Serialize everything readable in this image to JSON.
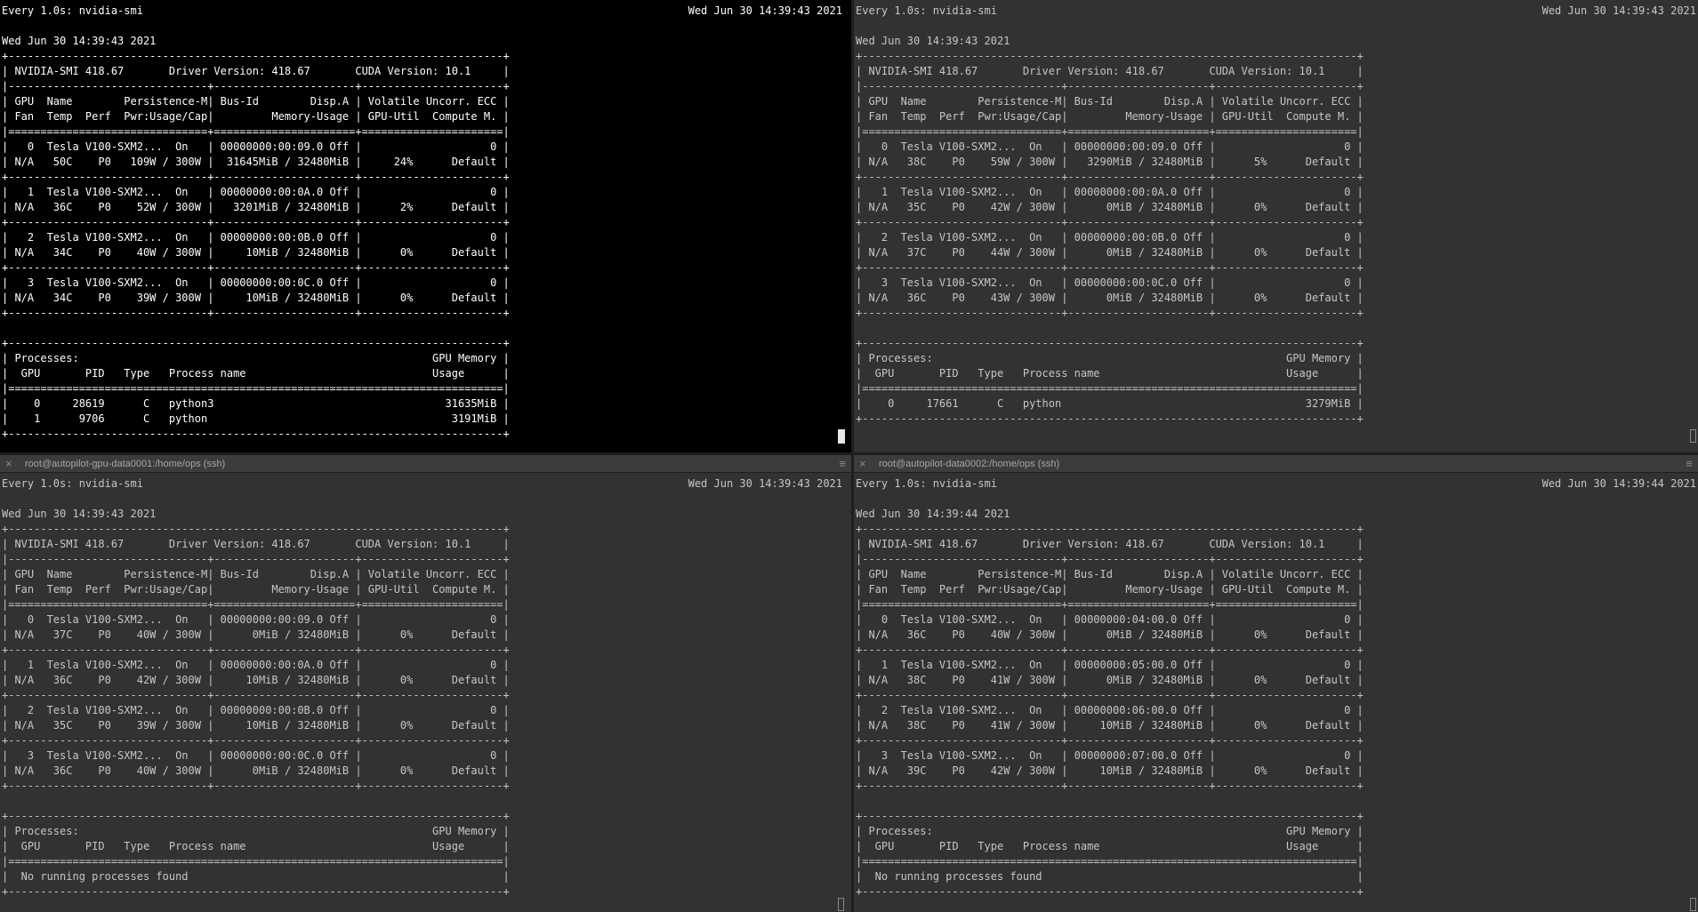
{
  "panes": [
    {
      "title": "",
      "watch_header": "Every 1.0s: nvidia-smi",
      "timestamp": "Wed Jun 30 14:39:43 2021",
      "date_line": "Wed Jun 30 14:39:43 2021",
      "smi_output": "+-----------------------------------------------------------------------------+\n| NVIDIA-SMI 418.67       Driver Version: 418.67       CUDA Version: 10.1     |\n|-------------------------------+----------------------+----------------------+\n| GPU  Name        Persistence-M| Bus-Id        Disp.A | Volatile Uncorr. ECC |\n| Fan  Temp  Perf  Pwr:Usage/Cap|         Memory-Usage | GPU-Util  Compute M. |\n|===============================+======================+======================|\n|   0  Tesla V100-SXM2...  On   | 00000000:00:09.0 Off |                    0 |\n| N/A   50C    P0   109W / 300W |  31645MiB / 32480MiB |     24%      Default |\n+-------------------------------+----------------------+----------------------+\n|   1  Tesla V100-SXM2...  On   | 00000000:00:0A.0 Off |                    0 |\n| N/A   36C    P0    52W / 300W |   3201MiB / 32480MiB |      2%      Default |\n+-------------------------------+----------------------+----------------------+\n|   2  Tesla V100-SXM2...  On   | 00000000:00:0B.0 Off |                    0 |\n| N/A   34C    P0    40W / 300W |     10MiB / 32480MiB |      0%      Default |\n+-------------------------------+----------------------+----------------------+\n|   3  Tesla V100-SXM2...  On   | 00000000:00:0C.0 Off |                    0 |\n| N/A   34C    P0    39W / 300W |     10MiB / 32480MiB |      0%      Default |\n+-------------------------------+----------------------+----------------------+\n\n+-----------------------------------------------------------------------------+\n| Processes:                                                       GPU Memory |\n|  GPU       PID   Type   Process name                             Usage      |\n|=============================================================================|\n|    0     28619      C   python3                                    31635MiB |\n|    1      9706      C   python                                      3191MiB |\n+-----------------------------------------------------------------------------+"
    },
    {
      "title": "",
      "watch_header": "Every 1.0s: nvidia-smi",
      "timestamp": "Wed Jun 30 14:39:43 2021",
      "date_line": "Wed Jun 30 14:39:43 2021",
      "smi_output": "+-----------------------------------------------------------------------------+\n| NVIDIA-SMI 418.67       Driver Version: 418.67       CUDA Version: 10.1     |\n|-------------------------------+----------------------+----------------------+\n| GPU  Name        Persistence-M| Bus-Id        Disp.A | Volatile Uncorr. ECC |\n| Fan  Temp  Perf  Pwr:Usage/Cap|         Memory-Usage | GPU-Util  Compute M. |\n|===============================+======================+======================|\n|   0  Tesla V100-SXM2...  On   | 00000000:00:09.0 Off |                    0 |\n| N/A   38C    P0    59W / 300W |   3290MiB / 32480MiB |      5%      Default |\n+-------------------------------+----------------------+----------------------+\n|   1  Tesla V100-SXM2...  On   | 00000000:00:0A.0 Off |                    0 |\n| N/A   35C    P0    42W / 300W |      0MiB / 32480MiB |      0%      Default |\n+-------------------------------+----------------------+----------------------+\n|   2  Tesla V100-SXM2...  On   | 00000000:00:0B.0 Off |                    0 |\n| N/A   37C    P0    44W / 300W |      0MiB / 32480MiB |      0%      Default |\n+-------------------------------+----------------------+----------------------+\n|   3  Tesla V100-SXM2...  On   | 00000000:00:0C.0 Off |                    0 |\n| N/A   36C    P0    43W / 300W |      0MiB / 32480MiB |      0%      Default |\n+-------------------------------+----------------------+----------------------+\n\n+-----------------------------------------------------------------------------+\n| Processes:                                                       GPU Memory |\n|  GPU       PID   Type   Process name                             Usage      |\n|=============================================================================|\n|    0     17661      C   python                                      3279MiB |\n+-----------------------------------------------------------------------------+"
    },
    {
      "title": "root@autopilot-gpu-data0001:/home/ops (ssh)",
      "watch_header": "Every 1.0s: nvidia-smi",
      "timestamp": "Wed Jun 30 14:39:43 2021",
      "date_line": "Wed Jun 30 14:39:43 2021",
      "smi_output": "+-----------------------------------------------------------------------------+\n| NVIDIA-SMI 418.67       Driver Version: 418.67       CUDA Version: 10.1     |\n|-------------------------------+----------------------+----------------------+\n| GPU  Name        Persistence-M| Bus-Id        Disp.A | Volatile Uncorr. ECC |\n| Fan  Temp  Perf  Pwr:Usage/Cap|         Memory-Usage | GPU-Util  Compute M. |\n|===============================+======================+======================|\n|   0  Tesla V100-SXM2...  On   | 00000000:00:09.0 Off |                    0 |\n| N/A   37C    P0    40W / 300W |      0MiB / 32480MiB |      0%      Default |\n+-------------------------------+----------------------+----------------------+\n|   1  Tesla V100-SXM2...  On   | 00000000:00:0A.0 Off |                    0 |\n| N/A   36C    P0    42W / 300W |     10MiB / 32480MiB |      0%      Default |\n+-------------------------------+----------------------+----------------------+\n|   2  Tesla V100-SXM2...  On   | 00000000:00:0B.0 Off |                    0 |\n| N/A   35C    P0    39W / 300W |     10MiB / 32480MiB |      0%      Default |\n+-------------------------------+----------------------+----------------------+\n|   3  Tesla V100-SXM2...  On   | 00000000:00:0C.0 Off |                    0 |\n| N/A   36C    P0    40W / 300W |      0MiB / 32480MiB |      0%      Default |\n+-------------------------------+----------------------+----------------------+\n\n+-----------------------------------------------------------------------------+\n| Processes:                                                       GPU Memory |\n|  GPU       PID   Type   Process name                             Usage      |\n|=============================================================================|\n|  No running processes found                                                 |\n+-----------------------------------------------------------------------------+"
    },
    {
      "title": "root@autopilot-data0002:/home/ops (ssh)",
      "watch_header": "Every 1.0s: nvidia-smi",
      "timestamp": "Wed Jun 30 14:39:44 2021",
      "date_line": "Wed Jun 30 14:39:44 2021",
      "smi_output": "+-----------------------------------------------------------------------------+\n| NVIDIA-SMI 418.67       Driver Version: 418.67       CUDA Version: 10.1     |\n|-------------------------------+----------------------+----------------------+\n| GPU  Name        Persistence-M| Bus-Id        Disp.A | Volatile Uncorr. ECC |\n| Fan  Temp  Perf  Pwr:Usage/Cap|         Memory-Usage | GPU-Util  Compute M. |\n|===============================+======================+======================|\n|   0  Tesla V100-SXM2...  On   | 00000000:04:00.0 Off |                    0 |\n| N/A   36C    P0    40W / 300W |      0MiB / 32480MiB |      0%      Default |\n+-------------------------------+----------------------+----------------------+\n|   1  Tesla V100-SXM2...  On   | 00000000:05:00.0 Off |                    0 |\n| N/A   38C    P0    41W / 300W |      0MiB / 32480MiB |      0%      Default |\n+-------------------------------+----------------------+----------------------+\n|   2  Tesla V100-SXM2...  On   | 00000000:06:00.0 Off |                    0 |\n| N/A   38C    P0    41W / 300W |     10MiB / 32480MiB |      0%      Default |\n+-------------------------------+----------------------+----------------------+\n|   3  Tesla V100-SXM2...  On   | 00000000:07:00.0 Off |                    0 |\n| N/A   39C    P0    42W / 300W |     10MiB / 32480MiB |      0%      Default |\n+-------------------------------+----------------------+----------------------+\n\n+-----------------------------------------------------------------------------+\n| Processes:                                                       GPU Memory |\n|  GPU       PID   Type   Process name                             Usage      |\n|=============================================================================|\n|  No running processes found                                                 |\n+-----------------------------------------------------------------------------+"
    }
  ],
  "icons": {
    "close": "×",
    "menu": "≡"
  },
  "colors": {
    "active_bg": "#000000",
    "inactive_bg": "#323232",
    "active_text": "#ffffff",
    "inactive_text": "#c6c6c6"
  }
}
